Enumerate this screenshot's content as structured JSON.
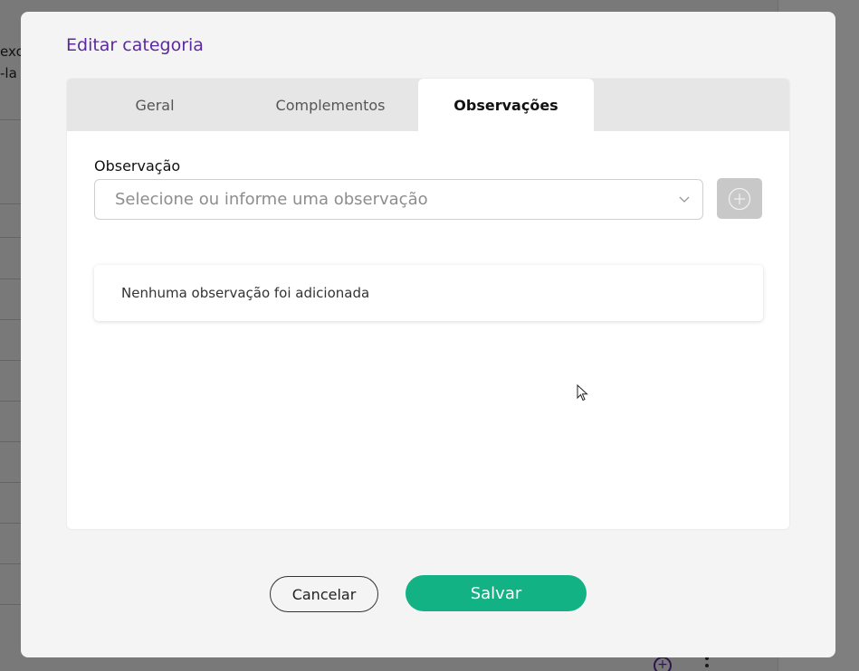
{
  "background": {
    "text_line_1": "exc",
    "text_line_2": "-la"
  },
  "modal": {
    "title": "Editar categoria",
    "tabs": [
      {
        "label": "Geral",
        "active": false
      },
      {
        "label": "Complementos",
        "active": false
      },
      {
        "label": "Observações",
        "active": true
      }
    ],
    "field_label": "Observação",
    "select_placeholder": "Selecione ou informe uma observação",
    "empty_message": "Nenhuma observação foi adicionada",
    "cancel_label": "Cancelar",
    "save_label": "Salvar"
  },
  "colors": {
    "title": "#5b2a9e",
    "save_button": "#12b285",
    "add_button": "#c8c8c8"
  },
  "icons": {
    "add": "plus-circle-icon",
    "select": "chevron-down-icon",
    "cursor": "mouse-pointer-icon"
  }
}
